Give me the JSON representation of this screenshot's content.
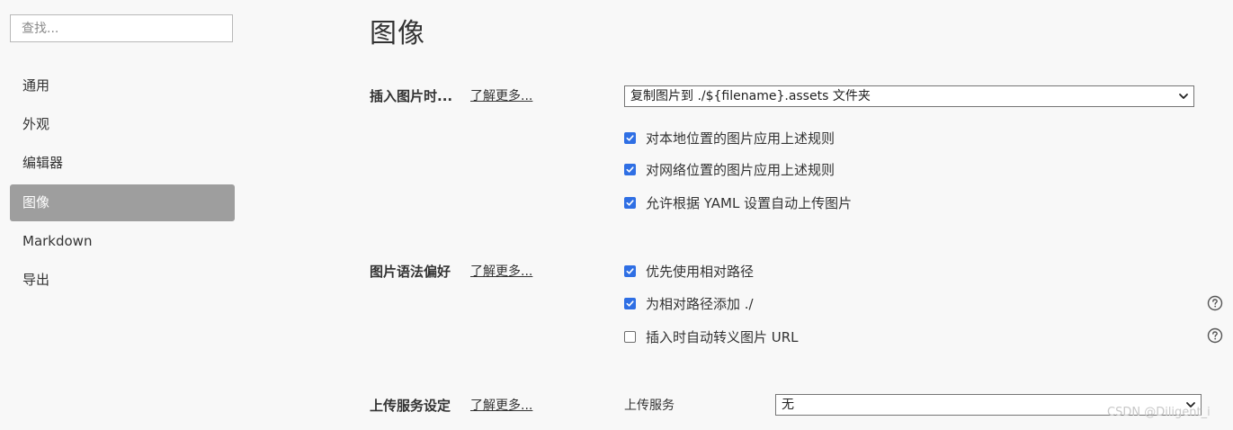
{
  "search": {
    "placeholder": "查找..."
  },
  "sidebar": {
    "items": [
      {
        "label": "通用"
      },
      {
        "label": "外观"
      },
      {
        "label": "编辑器"
      },
      {
        "label": "图像",
        "active": true
      },
      {
        "label": "Markdown"
      },
      {
        "label": "导出"
      }
    ]
  },
  "main": {
    "title": "图像",
    "learn_more": "了解更多...",
    "insert": {
      "label": "插入图片时...",
      "select_value": "复制图片到 ./${filename}.assets 文件夹",
      "options": [
        {
          "label": "对本地位置的图片应用上述规则",
          "checked": true
        },
        {
          "label": "对网络位置的图片应用上述规则",
          "checked": true
        },
        {
          "label": "允许根据 YAML 设置自动上传图片",
          "checked": true
        }
      ]
    },
    "syntax": {
      "label": "图片语法偏好",
      "options": [
        {
          "label": "优先使用相对路径",
          "checked": true
        },
        {
          "label": "为相对路径添加 ./",
          "checked": true,
          "help": true
        },
        {
          "label": "插入时自动转义图片 URL",
          "checked": false,
          "help": true
        }
      ]
    },
    "upload": {
      "label": "上传服务设定",
      "service_label": "上传服务",
      "service_value": "无"
    }
  },
  "watermark": "CSDN @Diligent_i",
  "colors": {
    "accent": "#2f6fe4",
    "active_nav": "#9e9e9e",
    "background": "#f8f8f8"
  }
}
